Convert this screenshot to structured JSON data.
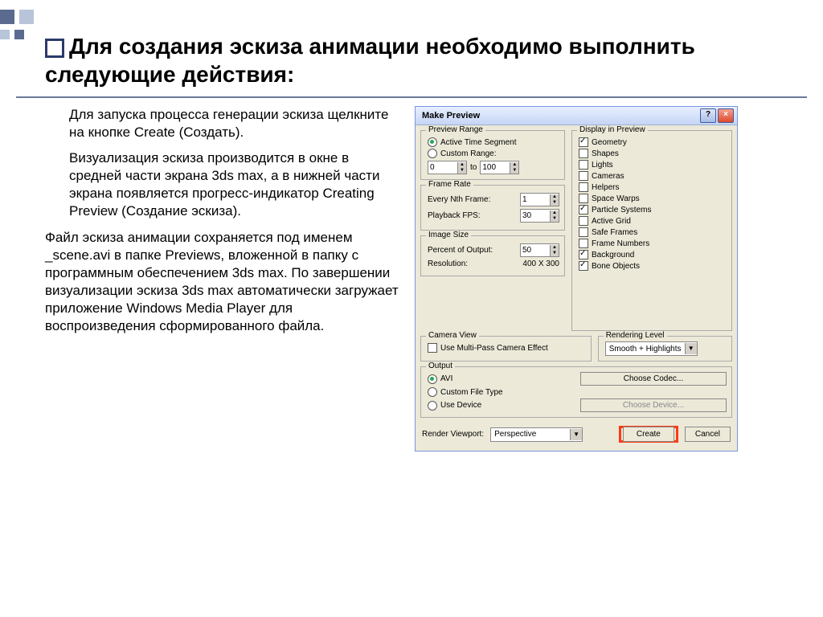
{
  "heading": "Для создания эскиза анимации необходимо выполнить следующие действия:",
  "para": {
    "p1": "Для запуска процесса генерации эскиза щелкните на кнопке Create (Создать).",
    "p2": "Визуализация эскиза производится в окне в средней части экрана 3ds max, а в нижней части экрана появляется прогресс-индикатор Creating Preview (Создание эскиза).",
    "p3": "Файл эскиза анимации сохраняется под именем _scene.avi в папке Previews, вложенной в папку с программным обеспечением 3ds max. По завершении визуализации эскиза 3ds max автоматически загружает приложение Windows Media Player для воспроизведения сформированного файла."
  },
  "dialog": {
    "title": "Make Preview",
    "groups": {
      "previewRange": "Preview Range",
      "frameRate": "Frame Rate",
      "imageSize": "Image Size",
      "cameraView": "Camera View",
      "displayInPreview": "Display in Preview",
      "renderingLevel": "Rendering Level",
      "output": "Output"
    },
    "previewRange": {
      "active": "Active Time Segment",
      "custom": "Custom Range:",
      "from": "0",
      "toLabel": "to",
      "to": "100"
    },
    "frameRate": {
      "nthLabel": "Every Nth Frame:",
      "nth": "1",
      "fpsLabel": "Playback FPS:",
      "fps": "30"
    },
    "imageSize": {
      "pctLabel": "Percent of Output:",
      "pct": "50",
      "resLabel": "Resolution:",
      "res": "400  X  300"
    },
    "cameraView": {
      "multiPass": "Use Multi-Pass Camera Effect"
    },
    "display": {
      "geometry": "Geometry",
      "shapes": "Shapes",
      "lights": "Lights",
      "cameras": "Cameras",
      "helpers": "Helpers",
      "spaceWarps": "Space Warps",
      "particleSystems": "Particle Systems",
      "activeGrid": "Active Grid",
      "safeFrames": "Safe Frames",
      "frameNumbers": "Frame Numbers",
      "background": "Background",
      "boneObjects": "Bone Objects"
    },
    "renderingLevel": {
      "value": "Smooth + Highlights"
    },
    "output": {
      "avi": "AVI",
      "customFile": "Custom File Type",
      "useDevice": "Use Device",
      "chooseCodec": "Choose Codec...",
      "chooseDevice": "Choose Device..."
    },
    "bottom": {
      "renderViewportLabel": "Render Viewport:",
      "viewport": "Perspective",
      "create": "Create",
      "cancel": "Cancel"
    }
  }
}
